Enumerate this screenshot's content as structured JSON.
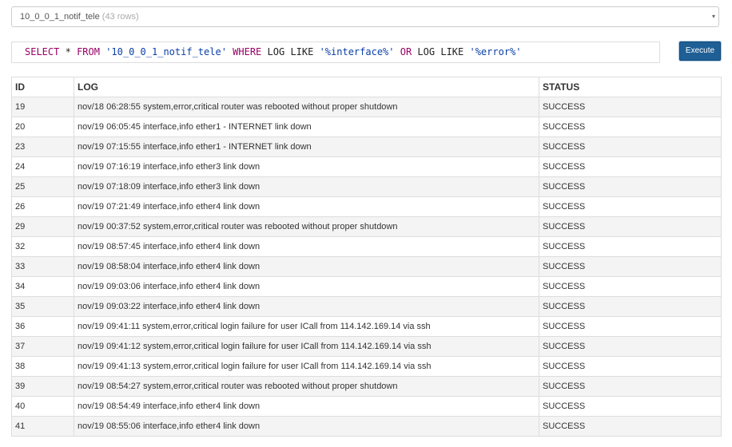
{
  "table_selector": {
    "name": "10_0_0_1_notif_tele",
    "rows_label": "(43 rows)",
    "caret": "▾"
  },
  "query": {
    "select": "SELECT",
    "star": "*",
    "from": "FROM",
    "table": "'10_0_0_1_notif_tele'",
    "where": "WHERE",
    "col1": "LOG",
    "like1": "LIKE",
    "pattern1": "'%interface%'",
    "or": "OR",
    "col2": "LOG",
    "like2": "LIKE",
    "pattern2": "'%error%'"
  },
  "execute_label": "Execute",
  "columns": [
    "ID",
    "LOG",
    "STATUS"
  ],
  "rows": [
    {
      "id": "19",
      "log": "nov/18 06:28:55 system,error,critical router was rebooted without proper shutdown",
      "status": "SUCCESS"
    },
    {
      "id": "20",
      "log": "nov/19 06:05:45 interface,info ether1 - INTERNET link down",
      "status": "SUCCESS"
    },
    {
      "id": "23",
      "log": "nov/19 07:15:55 interface,info ether1 - INTERNET link down",
      "status": "SUCCESS"
    },
    {
      "id": "24",
      "log": "nov/19 07:16:19 interface,info ether3 link down",
      "status": "SUCCESS"
    },
    {
      "id": "25",
      "log": "nov/19 07:18:09 interface,info ether3 link down",
      "status": "SUCCESS"
    },
    {
      "id": "26",
      "log": "nov/19 07:21:49 interface,info ether4 link down",
      "status": "SUCCESS"
    },
    {
      "id": "29",
      "log": "nov/19 00:37:52 system,error,critical router was rebooted without proper shutdown",
      "status": "SUCCESS"
    },
    {
      "id": "32",
      "log": "nov/19 08:57:45 interface,info ether4 link down",
      "status": "SUCCESS"
    },
    {
      "id": "33",
      "log": "nov/19 08:58:04 interface,info ether4 link down",
      "status": "SUCCESS"
    },
    {
      "id": "34",
      "log": "nov/19 09:03:06 interface,info ether4 link down",
      "status": "SUCCESS"
    },
    {
      "id": "35",
      "log": "nov/19 09:03:22 interface,info ether4 link down",
      "status": "SUCCESS"
    },
    {
      "id": "36",
      "log": "nov/19 09:41:11 system,error,critical login failure for user ICall from 114.142.169.14 via ssh",
      "status": "SUCCESS"
    },
    {
      "id": "37",
      "log": "nov/19 09:41:12 system,error,critical login failure for user ICall from 114.142.169.14 via ssh",
      "status": "SUCCESS"
    },
    {
      "id": "38",
      "log": "nov/19 09:41:13 system,error,critical login failure for user ICall from 114.142.169.14 via ssh",
      "status": "SUCCESS"
    },
    {
      "id": "39",
      "log": "nov/19 08:54:27 system,error,critical router was rebooted without proper shutdown",
      "status": "SUCCESS"
    },
    {
      "id": "40",
      "log": "nov/19 08:54:49 interface,info ether4 link down",
      "status": "SUCCESS"
    },
    {
      "id": "41",
      "log": "nov/19 08:55:06 interface,info ether4 link down",
      "status": "SUCCESS"
    }
  ]
}
